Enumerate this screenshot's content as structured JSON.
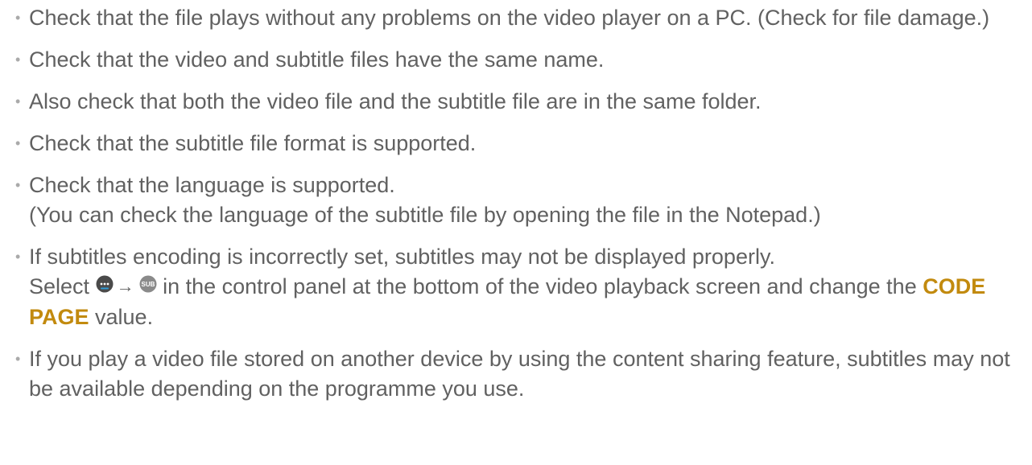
{
  "items": [
    {
      "text": "Check that the file plays without any problems on the video player on a PC. (Check for file damage.)"
    },
    {
      "text": "Check that the video and subtitle files have the same name."
    },
    {
      "text": "Also check that both the video file and the subtitle file are in the same folder."
    },
    {
      "text": "Check that the subtitle file format is supported."
    },
    {
      "line1": "Check that the language is supported.",
      "line2": "(You can check the language of the subtitle file by opening the file in the Notepad.)"
    },
    {
      "line1": "If subtitles encoding is incorrectly set, subtitles may not be displayed properly.",
      "select": "Select",
      "arrow": "→",
      "more_icon": "more-options-icon",
      "sub_icon": "subtitle-icon",
      "sub_icon_text": "SUB",
      "after_icons": "in the control panel at the bottom of the video playback screen and change the",
      "keyword": "CODE PAGE",
      "after_keyword": "value."
    },
    {
      "text": "If you play a video file stored on another device by using the content sharing feature, subtitles may not be available depending on the programme you use."
    }
  ],
  "colors": {
    "text": "#616161",
    "bullet": "#aaaaaa",
    "keyword": "#c28a0e",
    "more_icon_bg": "#4a4a4a",
    "more_icon_accent": "#2f9bd6",
    "sub_icon_bg": "#8a8a8a"
  }
}
